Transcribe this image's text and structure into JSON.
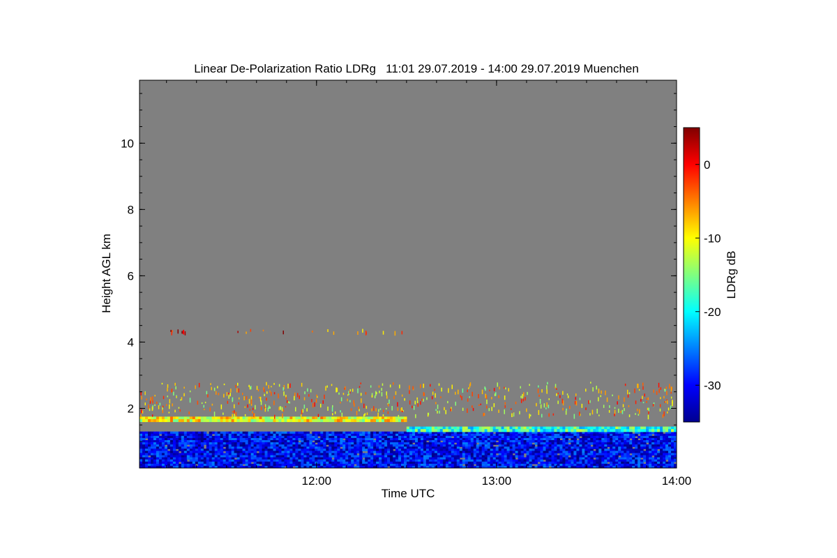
{
  "chart_data": {
    "type": "heatmap",
    "title": "Linear De-Polarization Ratio LDRg   11:01 29.07.2019 - 14:00 29.07.2019 Muenchen",
    "xlabel": "Time UTC",
    "ylabel": "Height AGL km",
    "colorbar_label": "LDRg dB",
    "x_range": [
      "11:01",
      "14:00"
    ],
    "x_ticks": [
      "12:00",
      "13:00",
      "14:00"
    ],
    "y_range": [
      0.2,
      11.9
    ],
    "y_ticks": [
      2,
      4,
      6,
      8,
      10
    ],
    "colorbar_range": [
      -35,
      5
    ],
    "colorbar_ticks": [
      0,
      -10,
      -20,
      -30
    ],
    "colormap": "jet",
    "no_data_color": "#808080",
    "layers": [
      {
        "height_km": [
          0.2,
          1.3
        ],
        "time_span": [
          "11:01",
          "14:00"
        ],
        "ldr_db": -30,
        "note_level": "low"
      },
      {
        "height_km": [
          1.6,
          1.75
        ],
        "time_span": [
          "11:01",
          "12:30"
        ],
        "ldr_db": -10
      },
      {
        "height_km": [
          1.3,
          1.45
        ],
        "time_span": [
          "12:30",
          "14:00"
        ],
        "ldr_db": -18
      },
      {
        "height_km": [
          1.8,
          2.8
        ],
        "time_span": [
          "11:01",
          "14:00"
        ],
        "ldr_db": -8,
        "pattern": "scattered"
      },
      {
        "height_km": [
          4.3,
          4.4
        ],
        "time_span": [
          "11:10",
          "12:30"
        ],
        "ldr_db": -2,
        "pattern": "scattered"
      }
    ]
  }
}
